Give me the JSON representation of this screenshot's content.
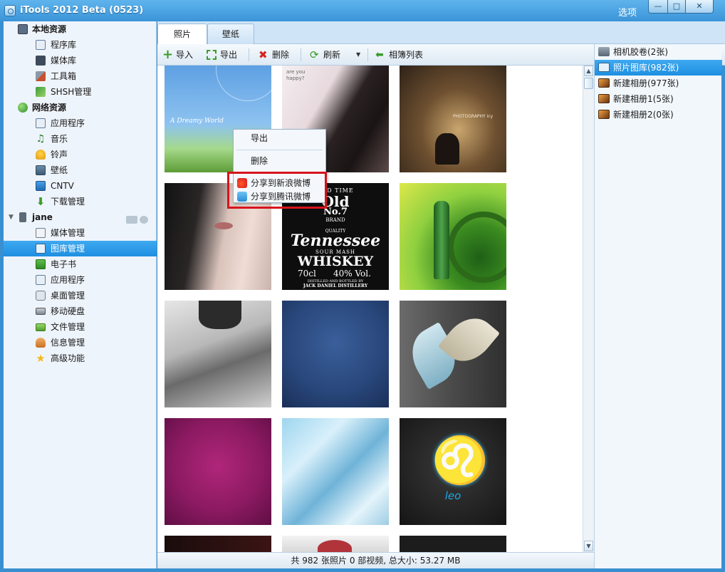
{
  "window": {
    "title": "iTools 2012 Beta (0523)",
    "options_label": "选项",
    "minimize_glyph": "—",
    "maximize_glyph": "□",
    "close_glyph": "✕"
  },
  "sidebar": {
    "groups": [
      {
        "label": "本地资源",
        "icon": "computer-icon",
        "items": [
          {
            "label": "程序库",
            "icon": "app-library-icon"
          },
          {
            "label": "媒体库",
            "icon": "media-library-icon"
          },
          {
            "label": "工具箱",
            "icon": "toolbox-icon"
          },
          {
            "label": "SHSH管理",
            "icon": "shsh-icon"
          }
        ]
      },
      {
        "label": "网络资源",
        "icon": "globe-icon",
        "items": [
          {
            "label": "应用程序",
            "icon": "app-icon"
          },
          {
            "label": "音乐",
            "icon": "music-note-icon"
          },
          {
            "label": "铃声",
            "icon": "bell-icon"
          },
          {
            "label": "壁纸",
            "icon": "wallpaper-icon"
          },
          {
            "label": "CNTV",
            "icon": "tv-icon"
          },
          {
            "label": "下载管理",
            "icon": "download-arrow-icon"
          }
        ]
      },
      {
        "label": "jane",
        "icon": "phone-icon",
        "expander": "▼",
        "items": [
          {
            "label": "媒体管理",
            "icon": "media-manage-icon"
          },
          {
            "label": "图库管理",
            "icon": "photo-library-icon",
            "selected": true
          },
          {
            "label": "电子书",
            "icon": "ebook-icon"
          },
          {
            "label": "应用程序",
            "icon": "app-icon"
          },
          {
            "label": "桌面管理",
            "icon": "desktop-icon"
          },
          {
            "label": "移动硬盘",
            "icon": "drive-icon"
          },
          {
            "label": "文件管理",
            "icon": "folder-icon"
          },
          {
            "label": "信息管理",
            "icon": "contact-icon"
          },
          {
            "label": "高级功能",
            "icon": "star-icon"
          }
        ]
      }
    ]
  },
  "tabs": [
    {
      "label": "照片",
      "active": true
    },
    {
      "label": "壁纸",
      "active": false
    }
  ],
  "toolbar": {
    "import": "导入",
    "export": "导出",
    "delete": "删除",
    "refresh": "刷新",
    "refresh_dropdown": "▼",
    "album_list": "相簿列表"
  },
  "gallery": {
    "thumbnails": [
      {
        "caption": "A Dreamy World"
      },
      {
        "caption": "are you happy?"
      },
      {
        "caption": "PHOTOGRAPHY icy"
      },
      {
        "caption": ""
      },
      {
        "caption": "Jennessee WHISKEY 70cl 40% Vol."
      },
      {
        "caption": ""
      },
      {
        "caption": ""
      },
      {
        "caption": ""
      },
      {
        "caption": ""
      },
      {
        "caption": ""
      },
      {
        "caption": ""
      },
      {
        "caption": "leo"
      }
    ],
    "whiskey": {
      "line1": "OLD TIME",
      "line2": "Old",
      "line3": "No.7",
      "line4": "BRAND",
      "line5": "QUALITY",
      "line6": "Tennessee",
      "line7": "SOUR MASH",
      "line8": "WHISKEY",
      "line9": "70cl",
      "line10": "40% Vol.",
      "line11": "DISTILLED AND BOTTLED BY",
      "line12": "JACK DANIEL DISTILLERY"
    },
    "dreamy_caption": "A Dreamy World",
    "happy_caption": "are you happy?",
    "photography_caption": "PHOTOGRAPHY icy",
    "leo_caption": "leo"
  },
  "context_menu": {
    "export": "导出",
    "delete": "删除",
    "share_sina": "分享到新浪微博",
    "share_tencent": "分享到腾讯微博"
  },
  "albums": [
    {
      "label": "相机胶卷(2张)",
      "icon": "camera-icon"
    },
    {
      "label": "照片图库(982张)",
      "icon": "photo-library-icon",
      "selected": true
    },
    {
      "label": "新建相册(977张)",
      "icon": "album-icon"
    },
    {
      "label": "新建相册1(5张)",
      "icon": "album-icon"
    },
    {
      "label": "新建相册2(0张)",
      "icon": "album-icon"
    }
  ],
  "status": {
    "text": "共 982 张照片 0 部视频, 总大小: 53.27 MB"
  },
  "colors": {
    "title_bar": "#3b94d8",
    "selection": "#1e8fe1",
    "highlight_box": "#d6141c"
  }
}
